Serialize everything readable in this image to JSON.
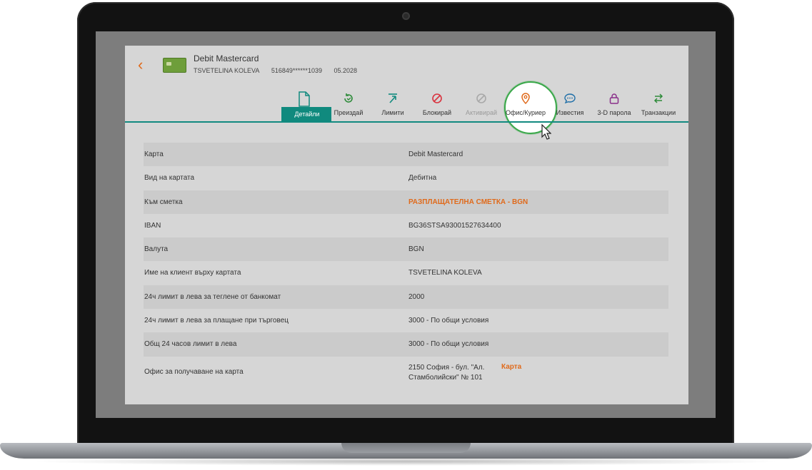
{
  "card": {
    "title": "Debit Mastercard",
    "holder": "TSVETELINA KOLEVA",
    "number": "516849******1039",
    "expiry": "05.2028"
  },
  "tabs": [
    {
      "label": "Детайли",
      "icon": "document-icon",
      "color": "#108a7e"
    },
    {
      "label": "Преиздай",
      "icon": "refresh-icon",
      "color": "#2e8b3a"
    },
    {
      "label": "Лимити",
      "icon": "limits-icon",
      "color": "#108a7e"
    },
    {
      "label": "Блокирай",
      "icon": "block-icon",
      "color": "#d9333f"
    },
    {
      "label": "Активирай",
      "icon": "activate-icon",
      "color": "#a8a8a8"
    },
    {
      "label": "Офис/Куриер",
      "icon": "location-pin-icon",
      "color": "#e06a1b"
    },
    {
      "label": "Известия",
      "icon": "chat-icon",
      "color": "#1f6fa8"
    },
    {
      "label": "3-D парола",
      "icon": "lock-icon",
      "color": "#8a2f8a"
    },
    {
      "label": "Транзакции",
      "icon": "transfer-icon",
      "color": "#2e8b3a"
    }
  ],
  "details": [
    {
      "key": "Карта",
      "value": "Debit Mastercard"
    },
    {
      "key": "Вид на картата",
      "value": "Дебитна"
    },
    {
      "key": "Към сметка",
      "value": "РАЗПЛАЩАТЕЛНА СМЕТКА - BGN"
    },
    {
      "key": "IBAN",
      "value": "BG36STSA93001527634400"
    },
    {
      "key": "Валута",
      "value": "BGN"
    },
    {
      "key": "Име на клиент върху картата",
      "value": "TSVETELINA KOLEVA"
    },
    {
      "key": "24ч лимит в лева за теглене от банкомат",
      "value": "2000"
    },
    {
      "key": "24ч лимит в лева за плащане при търговец",
      "value": "3000 - По общи условия"
    },
    {
      "key": "Общ 24 часов лимит в лева",
      "value": "3000 - По общи условия"
    },
    {
      "key": "Офис за получаване на карта",
      "value": "2150 София - бул. \"Ал. Стамболийски\" № 101",
      "link": "Карта"
    }
  ],
  "colors": {
    "accent": "#108a7e",
    "link": "#e06a1b"
  }
}
